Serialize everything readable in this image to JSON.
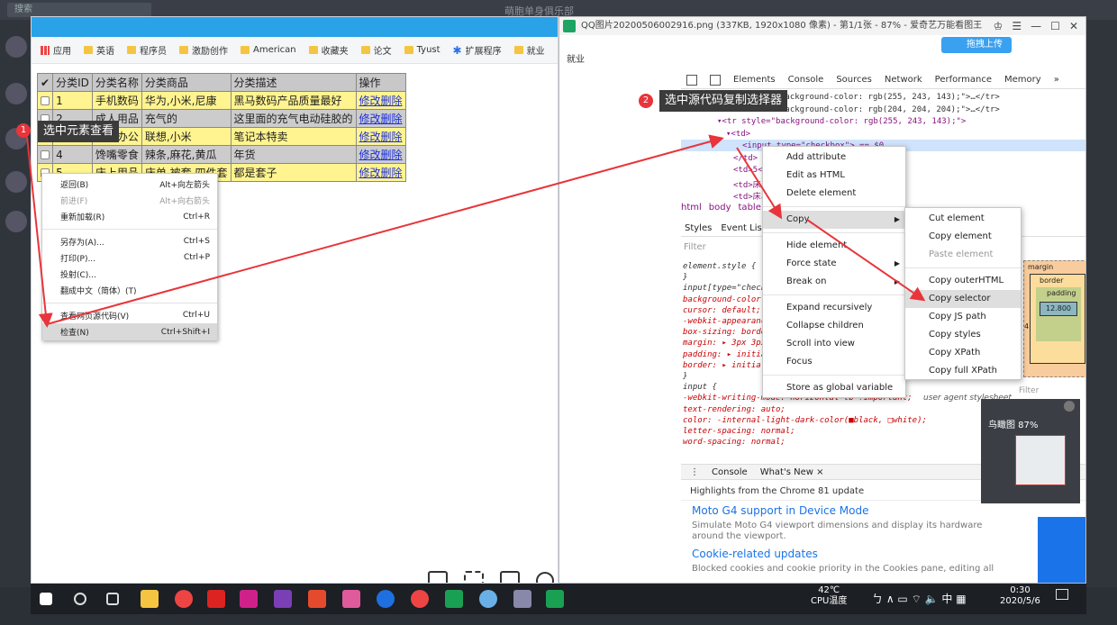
{
  "desktop": {
    "search_placeholder": "搜索",
    "bg_title": "萌胞单身俱乐部"
  },
  "browser": {
    "bookmarks": [
      {
        "label": "应用",
        "kind": "apps"
      },
      {
        "label": "英语",
        "kind": "folder"
      },
      {
        "label": "程序员",
        "kind": "folder"
      },
      {
        "label": "激励创作",
        "kind": "folder"
      },
      {
        "label": "American",
        "kind": "folder"
      },
      {
        "label": "收藏夹",
        "kind": "folder"
      },
      {
        "label": "论文",
        "kind": "folder"
      },
      {
        "label": "Tyust",
        "kind": "folder"
      },
      {
        "label": "扩展程序",
        "kind": "ext"
      },
      {
        "label": "就业",
        "kind": "folder"
      }
    ],
    "table": {
      "headers": [
        "✔",
        "分类ID",
        "分类名称",
        "分类商品",
        "分类描述",
        "操作"
      ],
      "rows": [
        {
          "id": "1",
          "name": "手机数码",
          "goods": "华为,小米,尼康",
          "desc": "黑马数码产品质量最好",
          "edit": "修改",
          "del": "删除"
        },
        {
          "id": "2",
          "name": "成人用品",
          "goods": "充气的",
          "desc": "这里面的充气电动硅胶的",
          "edit": "修改",
          "del": "删除"
        },
        {
          "id": "3",
          "name": "电脑办公",
          "goods": "联想,小米",
          "desc": "笔记本特卖",
          "edit": "修改",
          "del": "删除"
        },
        {
          "id": "4",
          "name": "馋嘴零食",
          "goods": "辣条,麻花,黄瓜",
          "desc": "年货",
          "edit": "修改",
          "del": "删除"
        },
        {
          "id": "5",
          "name": "床上用品",
          "goods": "床单,被套,四件套",
          "desc": "都是套子",
          "edit": "修改",
          "del": "删除"
        }
      ]
    },
    "context_menu": [
      {
        "label": "返回(B)",
        "shortcut": "Alt+向左箭头",
        "disabled": false
      },
      {
        "label": "前进(F)",
        "shortcut": "Alt+向右箭头",
        "disabled": true
      },
      {
        "label": "重新加载(R)",
        "shortcut": "Ctrl+R",
        "disabled": false
      },
      {
        "sep": true
      },
      {
        "label": "另存为(A)...",
        "shortcut": "Ctrl+S",
        "disabled": false
      },
      {
        "label": "打印(P)...",
        "shortcut": "Ctrl+P",
        "disabled": false
      },
      {
        "label": "投射(C)...",
        "shortcut": "",
        "disabled": false
      },
      {
        "label": "翻成中文（简体）(T)",
        "shortcut": "",
        "disabled": false
      },
      {
        "sep": true
      },
      {
        "label": "查看网页源代码(V)",
        "shortcut": "Ctrl+U",
        "disabled": false
      },
      {
        "label": "检查(N)",
        "shortcut": "Ctrl+Shift+I",
        "disabled": false,
        "selected": true
      }
    ],
    "annotation1": {
      "badge": "1",
      "text": "选中元素查看"
    }
  },
  "viewer": {
    "title": "QQ图片20200506002916.png (337KB, 1920x1080 像素) - 第1/1张 - 87% - 爱奇艺万能看图王",
    "upload": "拖拽上传",
    "just": "就业",
    "annotation2": {
      "badge": "2",
      "text": "选中源代码复制选择器"
    },
    "zoom_readout": "鸟瞰图  87%"
  },
  "devtools": {
    "tabs": [
      "Elements",
      "Console",
      "Sources",
      "Network",
      "Performance",
      "Memory",
      "»"
    ],
    "lines": [
      {
        "text": "background-color: rgb(255, 243, 143);\">…</tr>"
      },
      {
        "text": "background-color: rgb(204, 204, 204);\">…</tr>"
      },
      {
        "text": "▾<tr style=\"background-color: rgb(255, 243, 143);\">"
      },
      {
        "text": "▾<td>"
      },
      {
        "text": "<input type=\"checkbox\"> == $0"
      },
      {
        "text": "</td>"
      },
      {
        "text": "<td>5</td>"
      },
      {
        "text": "<td>床上用品</td>"
      },
      {
        "text": "<td>床单,被套,四件套</td>"
      }
    ],
    "crumbs": [
      "html",
      "body",
      "table"
    ],
    "styles_tabs": [
      "Styles",
      "Event Listeners"
    ],
    "filter": "Filter",
    "styles": [
      "element.style {",
      "}",
      "input[type=\"checkbox\"] {",
      "  background-color: initial;",
      "  cursor: default;",
      "  -webkit-appearance: checkbox;",
      "  box-sizing: border-box;",
      "  margin: ▸ 3px 3px 3px 4px;",
      "  padding: ▸ initial;",
      "  border: ▸ initial;",
      "}",
      "input {",
      "  -webkit-writing-mode: horizontal-tb !important;",
      "  text-rendering: auto;",
      "  color: -internal-light-dark-color(■black, □white);",
      "  letter-spacing: normal;",
      "  word-spacing: normal;"
    ],
    "user_agent": "user agent stylesheet",
    "box": {
      "margin": "margin",
      "border": "border",
      "padding": "padding",
      "content": "12.800",
      "left": "4"
    },
    "console_tabs": [
      "Console",
      "What's New ×"
    ],
    "highlights": "Highlights from the Chrome 81 update",
    "whatsnew": [
      {
        "h": "Moto G4 support in Device Mode",
        "p": "Simulate Moto G4 viewport dimensions and display its hardware around the viewport."
      },
      {
        "h": "Cookie-related updates",
        "p": "Blocked cookies and cookie priority in the Cookies pane, editing all"
      }
    ]
  },
  "menu1": [
    {
      "label": "Add attribute"
    },
    {
      "label": "Edit as HTML"
    },
    {
      "label": "Delete element"
    },
    {
      "sep": true
    },
    {
      "label": "Copy",
      "submenu": true,
      "selected": true
    },
    {
      "sep": true
    },
    {
      "label": "Hide element"
    },
    {
      "label": "Force state",
      "submenu": true
    },
    {
      "label": "Break on",
      "submenu": true
    },
    {
      "sep": true
    },
    {
      "label": "Expand recursively"
    },
    {
      "label": "Collapse children"
    },
    {
      "label": "Scroll into view"
    },
    {
      "label": "Focus"
    },
    {
      "sep": true
    },
    {
      "label": "Store as global variable"
    }
  ],
  "menu2": [
    {
      "label": "Cut element"
    },
    {
      "label": "Copy element"
    },
    {
      "label": "Paste element",
      "disabled": true
    },
    {
      "sep": true
    },
    {
      "label": "Copy outerHTML"
    },
    {
      "label": "Copy selector",
      "selected": true
    },
    {
      "label": "Copy JS path"
    },
    {
      "label": "Copy styles"
    },
    {
      "label": "Copy XPath"
    },
    {
      "label": "Copy full XPath"
    }
  ],
  "taskbar": {
    "temp": "42℃",
    "temp_label": "CPU温度",
    "tray_symbols": "ㄅ ∧ ▭ ⌔ 🔈 中 ▦",
    "time": "0:30",
    "date": "2020/5/6"
  },
  "colors": {
    "accent": "#2aa2e8",
    "row_yellow": "#fff48f",
    "row_gray": "#cccccc",
    "badge": "#e8343a"
  }
}
